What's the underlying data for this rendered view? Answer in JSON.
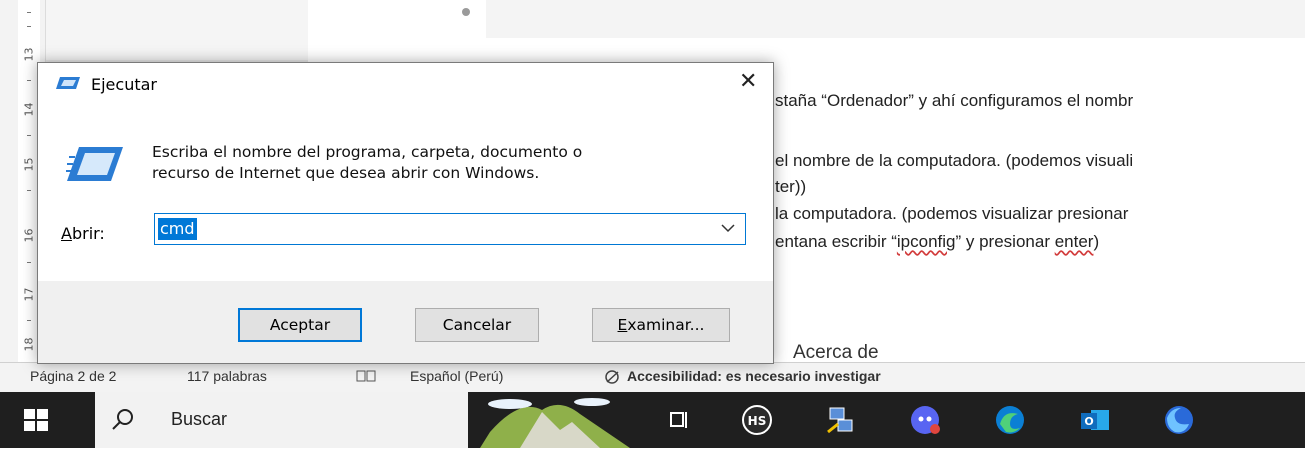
{
  "ruler": {
    "numbers": [
      "13",
      "14",
      "15",
      "16",
      "17",
      "18"
    ]
  },
  "document": {
    "lines": [
      "staña “Ordenador” y ahí configuramos el nombr",
      "el nombre de la computadora. (podemos visuali",
      "ter))",
      "la computadora. (podemos visualizar presionar",
      "entana escribir “",
      "ipconfig",
      "” y presionar ",
      "enter",
      ")"
    ],
    "section_heading": "Acerca de"
  },
  "status_bar": {
    "page": "Página 2 de 2",
    "words": "117 palabras",
    "language": "Español (Perú)",
    "accessibility": "Accesibilidad: es necesario investigar"
  },
  "taskbar": {
    "search_label": "Buscar",
    "icons": [
      "windows-start-icon",
      "search-icon",
      "news-weather-icon",
      "task-view-icon",
      "hs-app-icon",
      "network-app-icon",
      "discord-icon",
      "edge-icon",
      "outlook-new-icon",
      "firefox-icon"
    ]
  },
  "run_dialog": {
    "title": "Ejecutar",
    "description_line1": "Escriba el nombre del programa, carpeta, documento o",
    "description_line2": "recurso de Internet que desea abrir con Windows.",
    "open_label_underline": "A",
    "open_label_rest": "brir:",
    "open_value": "cmd",
    "buttons": {
      "ok": "Aceptar",
      "cancel": "Cancelar",
      "browse_underline": "E",
      "browse_rest": "xaminar..."
    }
  },
  "colors": {
    "accent": "#0078d7",
    "taskbar": "#1f1f1f",
    "dialog_footer": "#f0f0f0"
  }
}
